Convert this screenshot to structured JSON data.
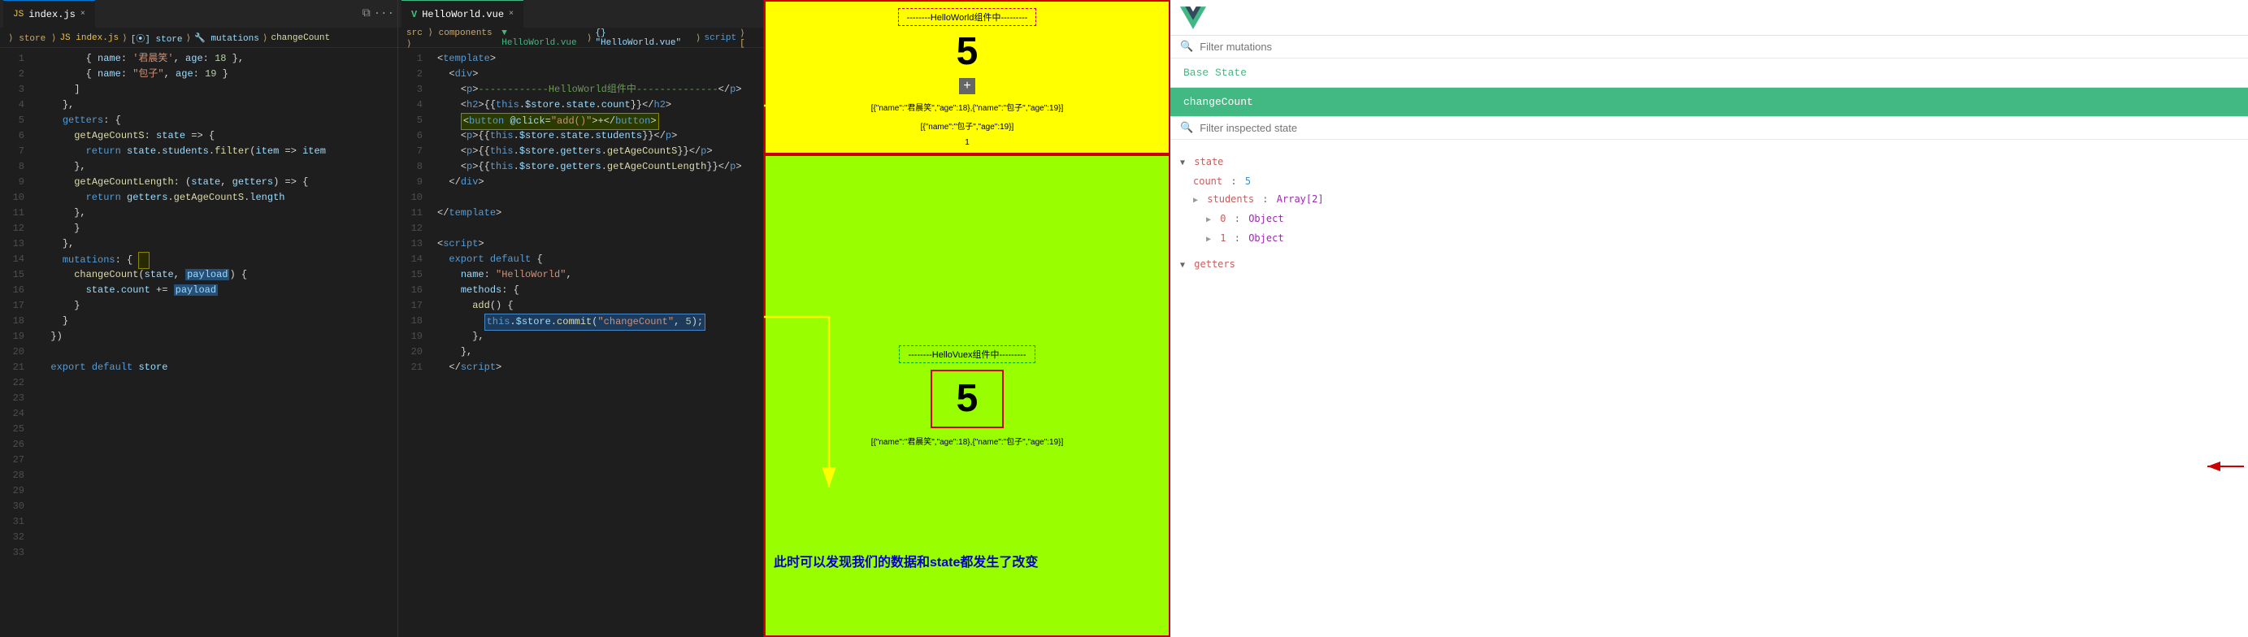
{
  "leftEditor": {
    "tabName": "index.js",
    "tabClose": "×",
    "breadcrumbs": [
      "store",
      "JS index.js",
      "store",
      "mutations",
      "changeCount"
    ],
    "lines": [
      {
        "num": 1,
        "code": ""
      },
      {
        "num": 2,
        "code": ""
      },
      {
        "num": 3,
        "code": ""
      },
      {
        "num": 4,
        "code": ""
      },
      {
        "num": 5,
        "code": ""
      },
      {
        "num": 6,
        "code": ""
      },
      {
        "num": 7,
        "code": ""
      },
      {
        "num": 8,
        "code": ""
      },
      {
        "num": 9,
        "code": ""
      },
      {
        "num": 10,
        "code": ""
      },
      {
        "num": 11,
        "code": ""
      },
      {
        "num": 12,
        "code": ""
      },
      {
        "num": 13,
        "code": ""
      },
      {
        "num": 14,
        "code": ""
      },
      {
        "num": 15,
        "code": ""
      },
      {
        "num": 16,
        "code": ""
      },
      {
        "num": 17,
        "code": ""
      },
      {
        "num": 18,
        "code": ""
      },
      {
        "num": 19,
        "code": ""
      },
      {
        "num": 20,
        "code": ""
      },
      {
        "num": 21,
        "code": ""
      },
      {
        "num": 22,
        "code": ""
      },
      {
        "num": 23,
        "code": ""
      },
      {
        "num": 24,
        "code": ""
      },
      {
        "num": 25,
        "code": ""
      },
      {
        "num": 26,
        "code": ""
      },
      {
        "num": 27,
        "code": ""
      },
      {
        "num": 28,
        "code": ""
      },
      {
        "num": 29,
        "code": ""
      },
      {
        "num": 30,
        "code": ""
      },
      {
        "num": 31,
        "code": ""
      },
      {
        "num": 32,
        "code": ""
      },
      {
        "num": 33,
        "code": ""
      }
    ]
  },
  "vueEditor": {
    "tabName": "HelloWorld.vue",
    "vueIcon": "V",
    "breadcrumbs": [
      "src",
      "components",
      "HelloWorld.vue",
      "{} \"HelloWorld.vue\"",
      "script"
    ]
  },
  "preview": {
    "topLabel": "--------HelloWorld组件中---------",
    "count": "5",
    "btnLabel": "+",
    "data1": "[{\"name\":\"君晨笑\",\"age\":18},{\"name\":\"包子\",\"age\":19}]",
    "data2": "[{\"name\":\"包子\",\"age\":19}]",
    "data3": "1",
    "bottomLabel": "--------HelloVuex组件中---------",
    "bottomCount": "5",
    "bottomData": "[{\"name\":\"君晨笑\",\"age\":18},{\"name\":\"包子\",\"age\":19}]",
    "annotation": "此时可以发现我们的数据和state都发生了改变"
  },
  "devtools": {
    "filterMutationsLabel": "Filter mutations",
    "filterMutationsPlaceholder": "Filter mutations",
    "baseStateLabel": "Base State",
    "changeCountLabel": "changeCount",
    "filterInspectedLabel": "Filter inspected state",
    "filterInspectedPlaceholder": "Filter inspected state",
    "stateSection": "▼ state",
    "stateCount": "count: 5",
    "stateStudents": "students: Array[2]",
    "stateItem0": "▶ 0: Object",
    "stateItem1": "▶ 1: Object",
    "gettersSection": "▼ getters"
  }
}
